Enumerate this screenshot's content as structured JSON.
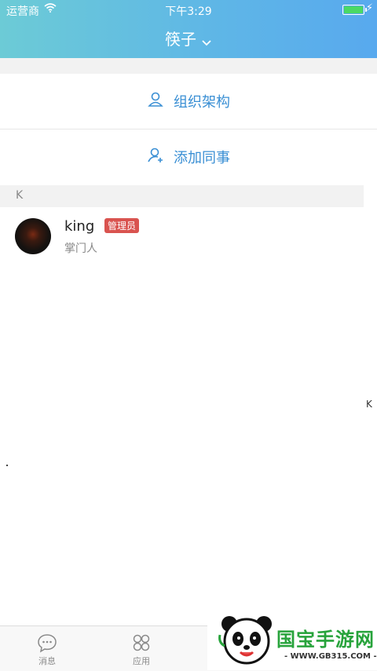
{
  "status_bar": {
    "carrier": "运营商",
    "time": "下午3:29"
  },
  "header": {
    "title": "筷子"
  },
  "actions": {
    "org_label": "组织架构",
    "add_label": "添加同事"
  },
  "section": {
    "letter": "K"
  },
  "contacts": [
    {
      "name": "king",
      "badge": "管理员",
      "role": "掌门人"
    }
  ],
  "side_index": {
    "letter": "K"
  },
  "tabbar": {
    "tabs": [
      {
        "label": "消息"
      },
      {
        "label": "应用"
      }
    ]
  },
  "watermark": {
    "text": "国宝手游网",
    "url": "- WWW.GB315.COM -"
  },
  "colors": {
    "header_start": "#6ccbd6",
    "header_end": "#58a9ee",
    "accent": "#3a8fd4",
    "badge": "#d9534f"
  }
}
